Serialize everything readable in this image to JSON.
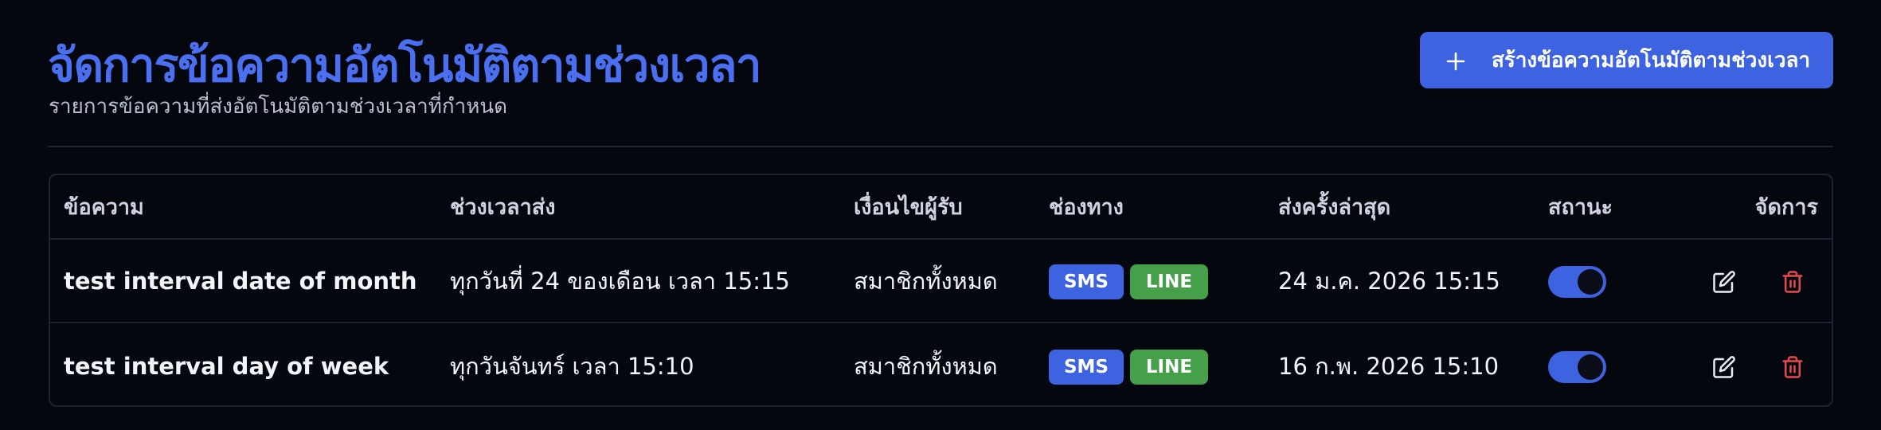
{
  "header": {
    "title": "จัดการข้อความอัตโนมัติตามช่วงเวลา",
    "subtitle": "รายการข้อความที่ส่งอัตโนมัติตามช่วงเวลาที่กำหนด",
    "create_button_label": "สร้างข้อความอัตโนมัติตามช่วงเวลา",
    "create_button_icon": "plus-icon"
  },
  "table": {
    "columns": [
      "ข้อความ",
      "ช่วงเวลาส่ง",
      "เงื่อนไขผู้รับ",
      "ช่องทาง",
      "ส่งครั้งล่าสุด",
      "สถานะ",
      "จัดการ"
    ],
    "rows": [
      {
        "message": "test interval date of month",
        "schedule": "ทุกวันที่ 24 ของเดือน เวลา 15:15",
        "recipients": "สมาชิกทั้งหมด",
        "channels": [
          "SMS",
          "LINE"
        ],
        "last_sent": "24 ม.ค. 2026 15:15",
        "status_enabled": true
      },
      {
        "message": "test interval day of week",
        "schedule": "ทุกวันจันทร์ เวลา 15:10",
        "recipients": "สมาชิกทั้งหมด",
        "channels": [
          "SMS",
          "LINE"
        ],
        "last_sent": "16 ก.พ. 2026 15:10",
        "status_enabled": true
      }
    ]
  },
  "colors": {
    "accent": "#3d63e0",
    "title": "#4a6ff0",
    "line_badge": "#45a049",
    "delete_icon": "#e5484d",
    "background": "#05070f"
  },
  "icons": {
    "edit": "edit-icon",
    "delete": "trash-icon"
  }
}
